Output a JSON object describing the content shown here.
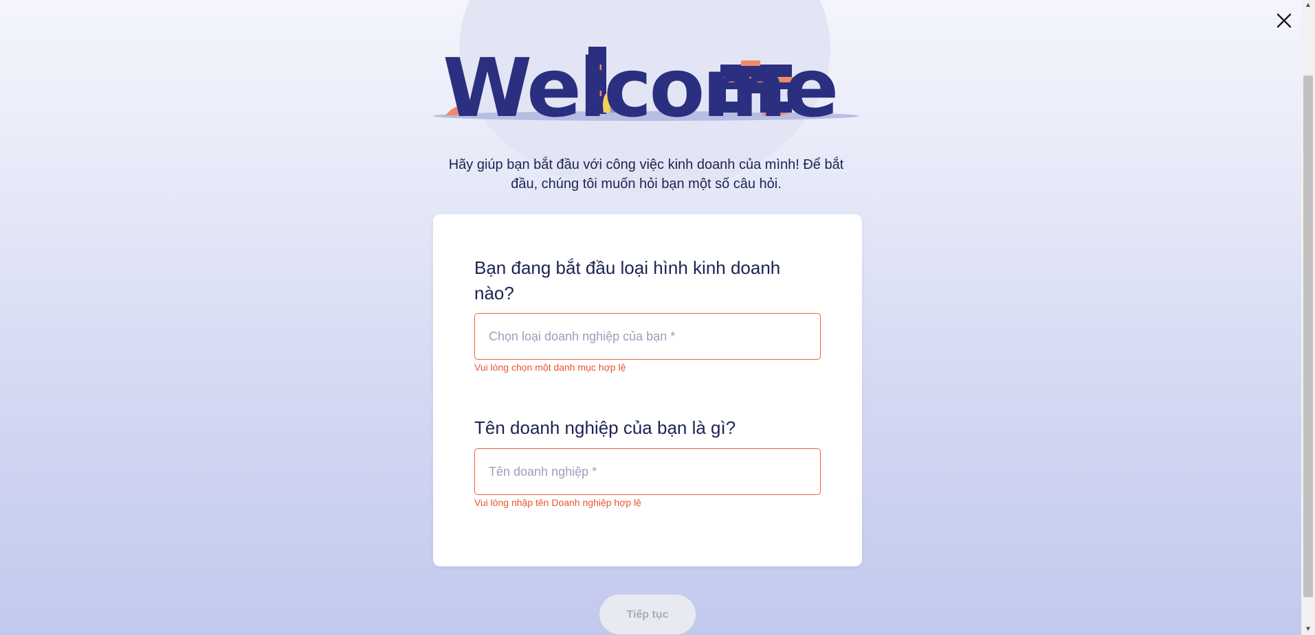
{
  "window": {
    "close_icon": "close-icon"
  },
  "hero": {
    "word": "Welcome"
  },
  "intro": {
    "text": "Hãy giúp bạn bắt đầu với công việc kinh doanh của mình! Để bắt đầu, chúng tôi muốn hỏi bạn một số câu hỏi."
  },
  "form": {
    "business_type": {
      "question": "Bạn đang bắt đầu loại hình kinh doanh nào?",
      "placeholder": "Chọn loại doanh nghiệp của bạn *",
      "error": "Vui lòng chọn một danh mục hợp lệ"
    },
    "business_name": {
      "question": "Tên doanh nghiệp của bạn là gì?",
      "placeholder": "Tên doanh nghiệp *",
      "error": "Vui lòng nhập tên Doanh nghiệp hợp lệ"
    },
    "continue_label": "Tiếp tục"
  },
  "colors": {
    "accent_error": "#ef6334",
    "heading": "#1c2354",
    "logo": "#2b2f80"
  }
}
